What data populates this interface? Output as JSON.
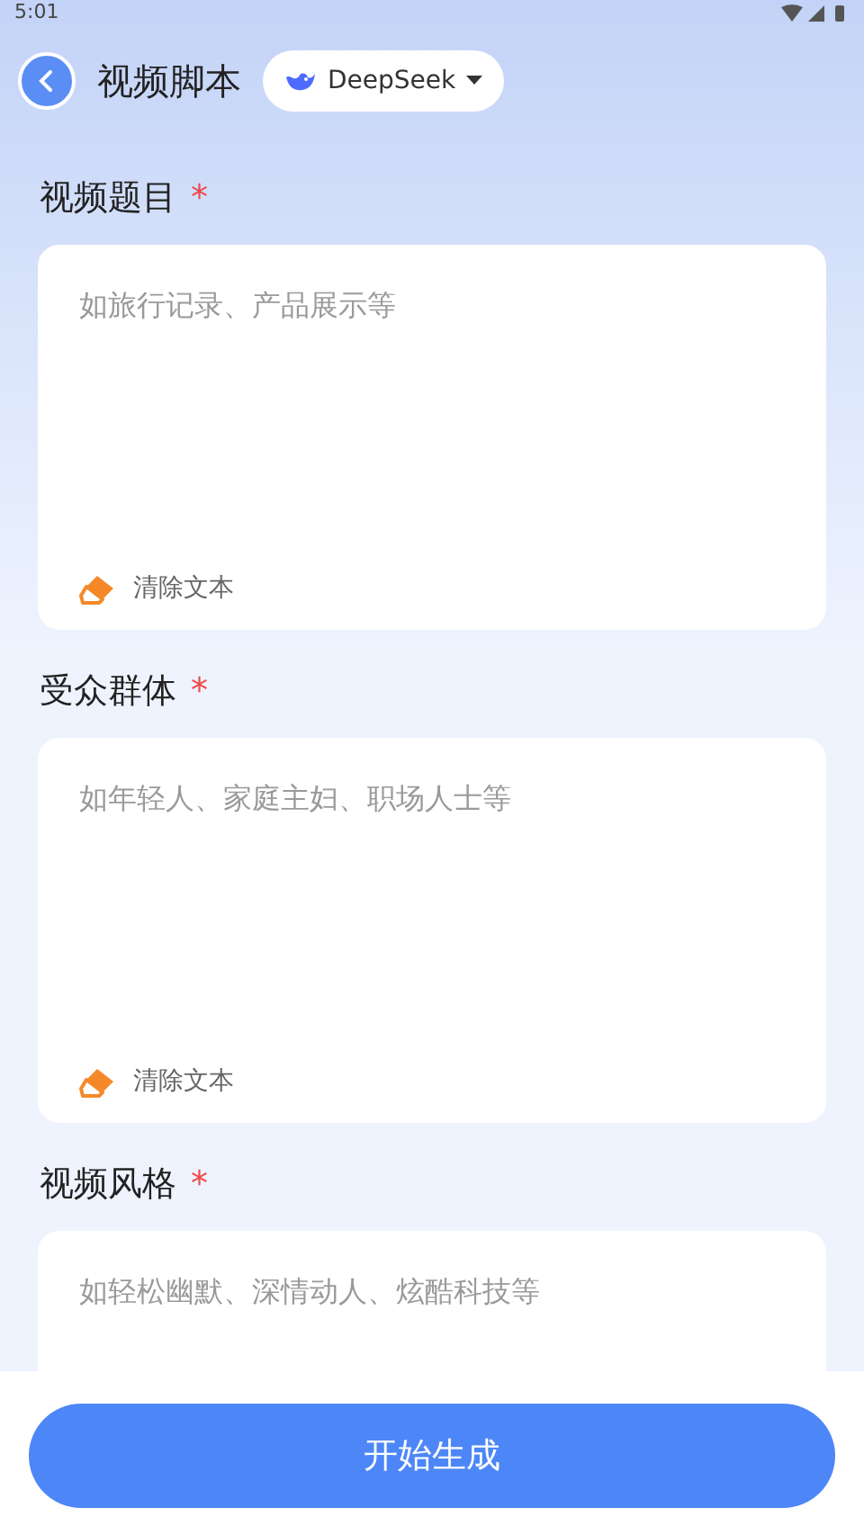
{
  "status_bar": {
    "time": "5:01"
  },
  "header": {
    "title": "视频脚本",
    "model": {
      "name": "DeepSeek"
    }
  },
  "fields": [
    {
      "label": "视频题目",
      "required_mark": "*",
      "placeholder": "如旅行记录、产品展示等",
      "clear_label": "清除文本"
    },
    {
      "label": "受众群体",
      "required_mark": "*",
      "placeholder": "如年轻人、家庭主妇、职场人士等",
      "clear_label": "清除文本"
    },
    {
      "label": "视频风格",
      "required_mark": "*",
      "placeholder": "如轻松幽默、深情动人、炫酷科技等"
    }
  ],
  "primary_button": {
    "label": "开始生成"
  }
}
